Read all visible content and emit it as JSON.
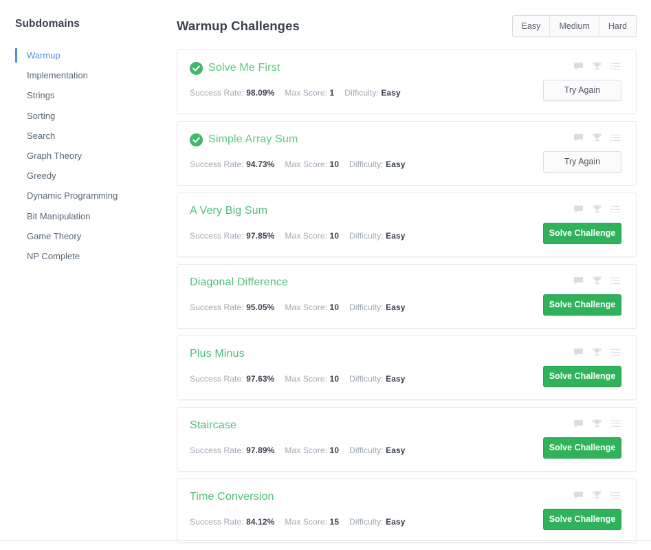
{
  "sidebar": {
    "title": "Subdomains",
    "items": [
      {
        "label": "Warmup",
        "active": true
      },
      {
        "label": "Implementation",
        "active": false
      },
      {
        "label": "Strings",
        "active": false
      },
      {
        "label": "Sorting",
        "active": false
      },
      {
        "label": "Search",
        "active": false
      },
      {
        "label": "Graph Theory",
        "active": false
      },
      {
        "label": "Greedy",
        "active": false
      },
      {
        "label": "Dynamic Programming",
        "active": false
      },
      {
        "label": "Bit Manipulation",
        "active": false
      },
      {
        "label": "Game Theory",
        "active": false
      },
      {
        "label": "NP Complete",
        "active": false
      }
    ]
  },
  "main": {
    "page_title": "Warmup Challenges",
    "difficulty_filters": [
      {
        "label": "Easy"
      },
      {
        "label": "Medium"
      },
      {
        "label": "Hard"
      }
    ],
    "labels": {
      "success_rate": "Success Rate:",
      "max_score": "Max Score:",
      "difficulty": "Difficulty:"
    },
    "card_icon_names": [
      "discussions-icon",
      "leaderboard-icon",
      "submissions-icon"
    ],
    "challenges": [
      {
        "name": "Solve Me First",
        "solved": true,
        "success_rate": "98.09%",
        "max_score": "1",
        "difficulty": "Easy",
        "action_label": "Try Again",
        "action_type": "try-again"
      },
      {
        "name": "Simple Array Sum",
        "solved": true,
        "success_rate": "94.73%",
        "max_score": "10",
        "difficulty": "Easy",
        "action_label": "Try Again",
        "action_type": "try-again"
      },
      {
        "name": "A Very Big Sum",
        "solved": false,
        "success_rate": "97.85%",
        "max_score": "10",
        "difficulty": "Easy",
        "action_label": "Solve Challenge",
        "action_type": "solve"
      },
      {
        "name": "Diagonal Difference",
        "solved": false,
        "success_rate": "95.05%",
        "max_score": "10",
        "difficulty": "Easy",
        "action_label": "Solve Challenge",
        "action_type": "solve"
      },
      {
        "name": "Plus Minus",
        "solved": false,
        "success_rate": "97.63%",
        "max_score": "10",
        "difficulty": "Easy",
        "action_label": "Solve Challenge",
        "action_type": "solve"
      },
      {
        "name": "Staircase",
        "solved": false,
        "success_rate": "97.89%",
        "max_score": "10",
        "difficulty": "Easy",
        "action_label": "Solve Challenge",
        "action_type": "solve"
      },
      {
        "name": "Time Conversion",
        "solved": false,
        "success_rate": "84.12%",
        "max_score": "15",
        "difficulty": "Easy",
        "action_label": "Solve Challenge",
        "action_type": "solve"
      }
    ]
  },
  "colors": {
    "accent_green": "#2fb25a",
    "challenge_link_green": "#4fbd7b",
    "solved_green": "#58c97f",
    "active_blue": "#4a90d9",
    "text_dark": "#39424e",
    "text_muted": "#9fa8b4"
  }
}
